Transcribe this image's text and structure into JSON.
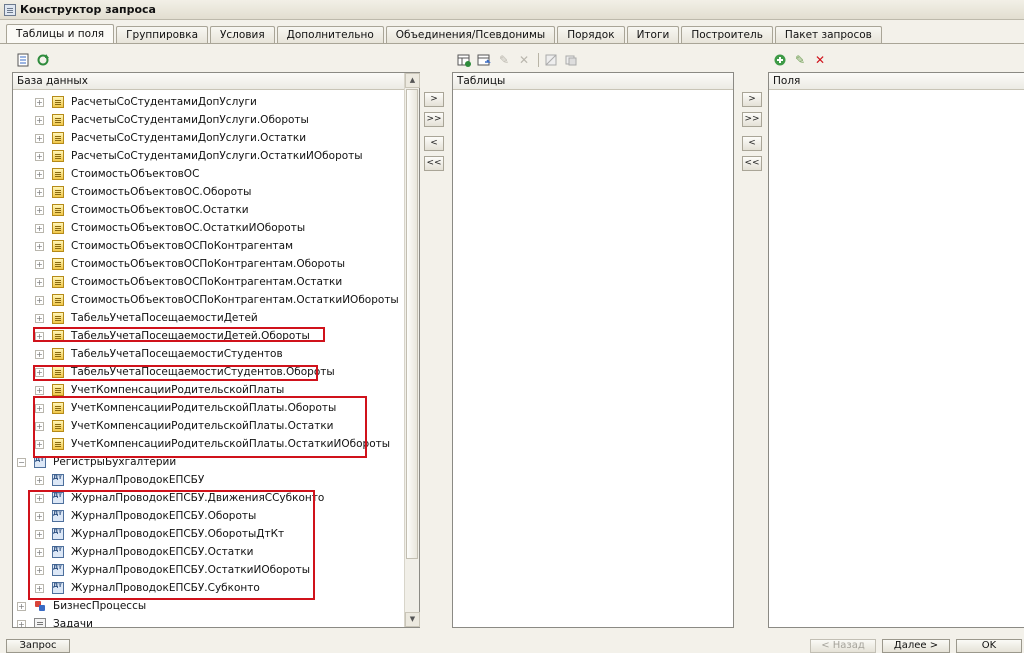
{
  "window": {
    "title": "Конструктор запроса"
  },
  "tabs": [
    {
      "label": "Таблицы и поля",
      "active": true
    },
    {
      "label": "Группировка"
    },
    {
      "label": "Условия"
    },
    {
      "label": "Дополнительно"
    },
    {
      "label": "Объединения/Псевдонимы"
    },
    {
      "label": "Порядок"
    },
    {
      "label": "Итоги"
    },
    {
      "label": "Построитель"
    },
    {
      "label": "Пакет запросов"
    }
  ],
  "db_panel": {
    "header": "База данных",
    "items": [
      {
        "label": "РасчетыСоСтудентамиДопУслуги",
        "icon": "register-icon"
      },
      {
        "label": "РасчетыСоСтудентамиДопУслуги.Обороты",
        "icon": "register-icon"
      },
      {
        "label": "РасчетыСоСтудентамиДопУслуги.Остатки",
        "icon": "register-icon"
      },
      {
        "label": "РасчетыСоСтудентамиДопУслуги.ОстаткиИОбороты",
        "icon": "register-icon"
      },
      {
        "label": "СтоимостьОбъектовОС",
        "icon": "register-icon"
      },
      {
        "label": "СтоимостьОбъектовОС.Обороты",
        "icon": "register-icon"
      },
      {
        "label": "СтоимостьОбъектовОС.Остатки",
        "icon": "register-icon"
      },
      {
        "label": "СтоимостьОбъектовОС.ОстаткиИОбороты",
        "icon": "register-icon"
      },
      {
        "label": "СтоимостьОбъектовОСПоКонтрагентам",
        "icon": "register-icon"
      },
      {
        "label": "СтоимостьОбъектовОСПоКонтрагентам.Обороты",
        "icon": "register-icon"
      },
      {
        "label": "СтоимостьОбъектовОСПоКонтрагентам.Остатки",
        "icon": "register-icon"
      },
      {
        "label": "СтоимостьОбъектовОСПоКонтрагентам.ОстаткиИОбороты",
        "icon": "register-icon"
      },
      {
        "label": "ТабельУчетаПосещаемостиДетей",
        "icon": "register-icon"
      },
      {
        "label": "ТабельУчетаПосещаемостиДетей.Обороты",
        "icon": "register-icon"
      },
      {
        "label": "ТабельУчетаПосещаемостиСтудентов",
        "icon": "register-icon"
      },
      {
        "label": "ТабельУчетаПосещаемостиСтудентов.Обороты",
        "icon": "register-icon"
      },
      {
        "label": "УчетКомпенсацииРодительскойПлаты",
        "icon": "register-icon"
      },
      {
        "label": "УчетКомпенсацииРодительскойПлаты.Обороты",
        "icon": "register-icon"
      },
      {
        "label": "УчетКомпенсацииРодительскойПлаты.Остатки",
        "icon": "register-icon"
      },
      {
        "label": "УчетКомпенсацииРодительскойПлаты.ОстаткиИОбороты",
        "icon": "register-icon"
      },
      {
        "label": "РегистрыБухгалтерии",
        "icon": "accounting-register-icon",
        "group": true
      },
      {
        "label": "ЖурналПроводокЕПСБУ",
        "icon": "accounting-register-icon"
      },
      {
        "label": "ЖурналПроводокЕПСБУ.ДвиженияССубконто",
        "icon": "accounting-register-icon"
      },
      {
        "label": "ЖурналПроводокЕПСБУ.Обороты",
        "icon": "accounting-register-icon"
      },
      {
        "label": "ЖурналПроводокЕПСБУ.ОборотыДтКт",
        "icon": "accounting-register-icon"
      },
      {
        "label": "ЖурналПроводокЕПСБУ.Остатки",
        "icon": "accounting-register-icon"
      },
      {
        "label": "ЖурналПроводокЕПСБУ.ОстаткиИОбороты",
        "icon": "accounting-register-icon"
      },
      {
        "label": "ЖурналПроводокЕПСБУ.Субконто",
        "icon": "accounting-register-icon"
      },
      {
        "label": "БизнесПроцессы",
        "icon": "business-process-icon",
        "group": true
      },
      {
        "label": "Задачи",
        "icon": "tasks-icon",
        "group": true
      }
    ]
  },
  "tables_panel": {
    "header": "Таблицы"
  },
  "fields_panel": {
    "header": "Поля"
  },
  "move_buttons": [
    ">",
    ">>",
    "<",
    "<<"
  ],
  "bottom": {
    "query_button": "Запрос",
    "back_button": "< Назад",
    "next_button": "Далее >",
    "ok_button": "OK"
  },
  "colors": {
    "highlight": "#d0121b",
    "window_bg": "#f3f1ea"
  }
}
